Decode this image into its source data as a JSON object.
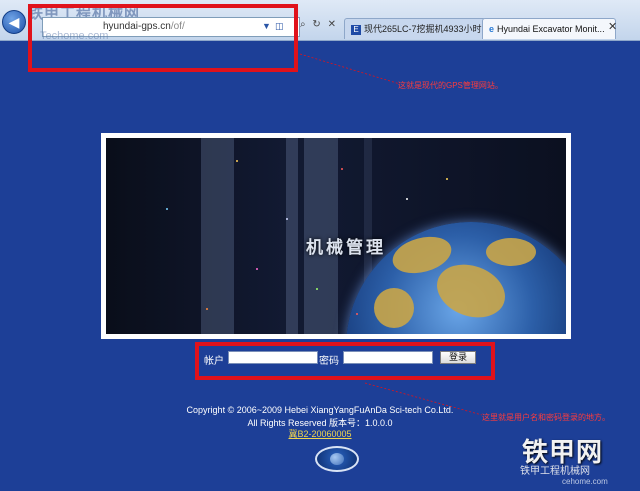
{
  "browser": {
    "watermark_top": "铁甲工程机械网",
    "watermark_sub": "Techome.com",
    "url_host": "hyundai-gps.cn",
    "url_path": "/of/",
    "tabs": [
      {
        "label": "现代265LC-7挖掘机4933小时..."
      },
      {
        "label": "Hyundai Excavator Monit..."
      }
    ],
    "close_glyph": "✕"
  },
  "annotations": {
    "address_note": "这就是现代的GPS管理网站。",
    "login_note": "这里就是用户名和密码登录的地方。"
  },
  "banner": {
    "title": "机械管理"
  },
  "login": {
    "username_label": "帐户",
    "password_label": "密码",
    "username_value": "",
    "password_value": "",
    "submit_label": "登录"
  },
  "footer": {
    "copyright": "Copyright © 2006~2009 Hebei XiangYangFuAnDa Sci-tech Co.Ltd.",
    "rights": "All Rights Reserved 版本号：1.0.0.0",
    "icp": "冀B2-20060005"
  },
  "watermark": {
    "logo": "铁甲网",
    "sub": "铁甲工程机械网",
    "url": "cehome.com"
  },
  "colors": {
    "page_bg": "#1d3f97",
    "annotation_red": "#e0121b",
    "link_yellow": "#f1d54c"
  }
}
